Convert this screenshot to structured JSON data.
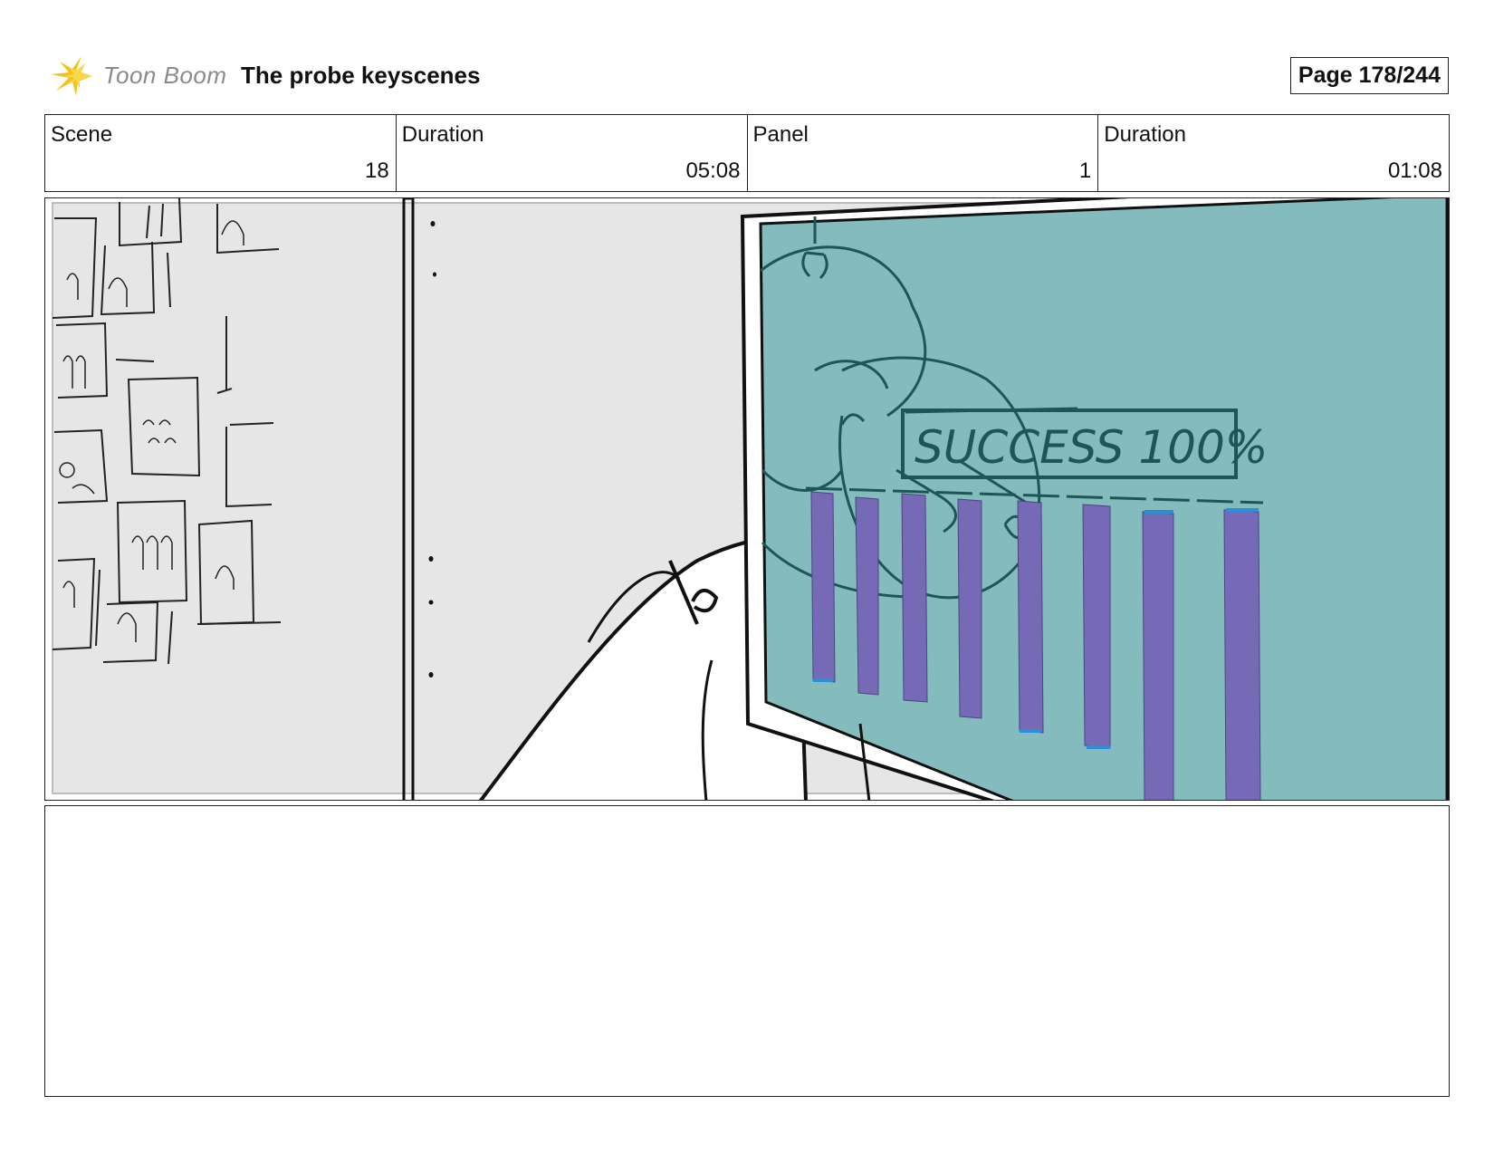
{
  "header": {
    "logo_text": "Toon Boom",
    "logo_icon": "star-burst-icon",
    "title": "The probe keyscenes",
    "page_label": "Page 178/244"
  },
  "info": {
    "scene_label": "Scene",
    "scene_value": "18",
    "scene_duration_label": "Duration",
    "scene_duration_value": "05:08",
    "panel_label": "Panel",
    "panel_value": "1",
    "panel_duration_label": "Duration",
    "panel_duration_value": "01:08"
  },
  "panel_image": {
    "screen_text": "SUCCESS 100%",
    "colors": {
      "wall": "#e6e6e6",
      "screen": "#84bcbe",
      "bars": "#7669b6",
      "sketch": "#1f5556"
    }
  },
  "colors": {
    "logo_yellow": "#f5c218",
    "border": "#222222"
  }
}
